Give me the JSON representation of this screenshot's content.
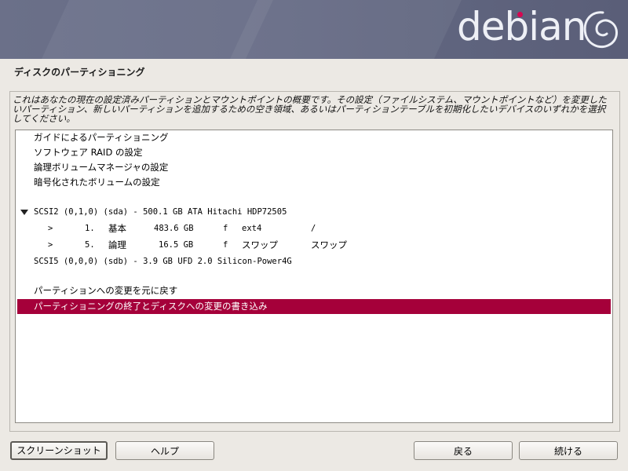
{
  "brand": {
    "name": "debian"
  },
  "page": {
    "title": "ディスクのパーティショニング"
  },
  "description": "これはあなたの現在の設定済みパーティションとマウントポイントの概要です。その設定（ファイルシステム、マウントポイントなど）を変更したいパーティション、新しいパーティションを追加するための空き領域、あるいはパーティションテーブルを初期化したいデバイスのいずれかを選択してください。",
  "items": {
    "guided": "ガイドによるパーティショニング",
    "raid": "ソフトウェア RAID の設定",
    "lvm": "論理ボリュームマネージャの設定",
    "crypto": "暗号化されたボリュームの設定",
    "disk1": "SCSI2 (0,1,0) (sda) - 500.1 GB ATA Hitachi HDP72505",
    "partitions": [
      {
        "marker": ">",
        "number": "1.",
        "type": "基本",
        "size": "483.6 GB",
        "flag": "f",
        "fs": "ext4",
        "mount": "/"
      },
      {
        "marker": ">",
        "number": "5.",
        "type": "論理",
        "size": "16.5 GB",
        "flag": "f",
        "fs": "スワップ",
        "mount": "スワップ"
      }
    ],
    "disk2": "SCSI5 (0,0,0) (sdb) - 3.9 GB UFD 2.0 Silicon-Power4G",
    "undo": "パーティションへの変更を元に戻す",
    "finish": "パーティショニングの終了とディスクへの変更の書き込み"
  },
  "buttons": {
    "screenshot": "スクリーンショット",
    "help": "ヘルプ",
    "back": "戻る",
    "continue": "続ける"
  },
  "colors": {
    "selection": "#a5003a",
    "logo_dot": "#d70751"
  }
}
